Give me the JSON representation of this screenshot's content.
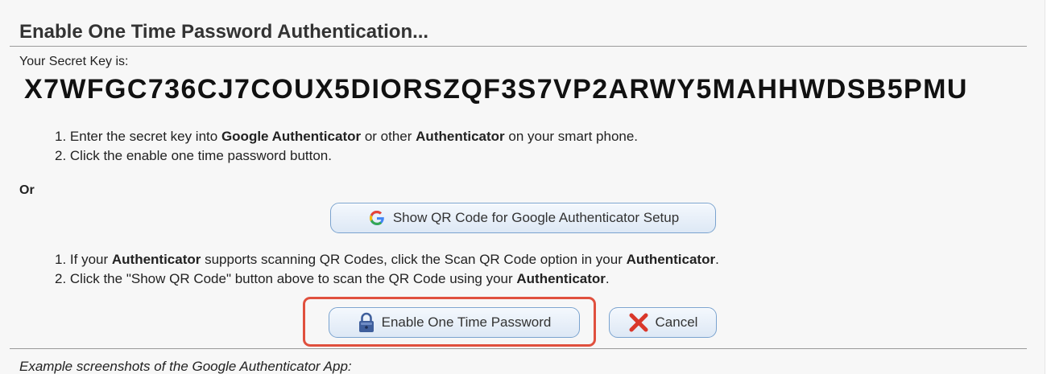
{
  "title": "Enable One Time Password Authentication...",
  "secret_label": "Your Secret Key is:",
  "secret_key": "X7WFGC736CJ7COUX5DIORSZQF3S7VP2ARWY5MAHHWDSB5PMU",
  "steps_manual": [
    {
      "n": "1. ",
      "a": "Enter the secret key into ",
      "b1": "Google Authenticator",
      "c": " or other ",
      "b2": "Authenticator",
      "d": " on your smart phone."
    },
    {
      "n": "2. ",
      "a": "Click the enable one time password button."
    }
  ],
  "or_label": "Or",
  "qr_button": {
    "label": "Show QR Code for Google Authenticator Setup",
    "icon": "google-g-icon"
  },
  "steps_qr": [
    {
      "n": "1. ",
      "a": "If your ",
      "b1": "Authenticator",
      "c": " supports scanning QR Codes, click the Scan QR Code option in your ",
      "b2": "Authenticator",
      "d": "."
    },
    {
      "n": "2. ",
      "a": "Click the \"Show QR Code\" button above to scan the QR Code using your ",
      "b1": "Authenticator",
      "c": "."
    }
  ],
  "enable_button": {
    "label": "Enable One Time Password",
    "icon": "lock-icon"
  },
  "cancel_button": {
    "label": "Cancel",
    "icon": "red-x-icon"
  },
  "example_label": "Example screenshots of the Google Authenticator App:",
  "colors": {
    "highlight": "#e0503e",
    "button_border": "#7aa3cf",
    "cancel_x": "#d9372b",
    "lock": "#3f5f9c"
  }
}
